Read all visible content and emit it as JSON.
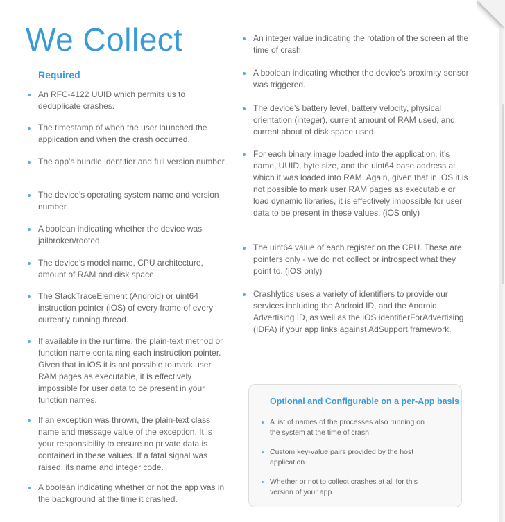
{
  "title": "We Collect",
  "required_heading": "Required",
  "left_items": [
    "An RFC-4122 UUID which permits us to deduplicate crashes.",
    "The timestamp of when the user launched the application and when the crash occurred.",
    "The app’s bundle identifier and full version number.",
    "The device’s operating system name and version number.",
    "A boolean indicating whether the device was jailbroken/rooted.",
    "The device’s model name, CPU architecture, amount of RAM and disk space.",
    "The StackTraceElement (Android) or uint64 instruction pointer (iOS) of every frame of every currently running thread.",
    "If available in the runtime, the plain-text method or function name containing each instruction pointer. Given that in iOS it is not possible to mark user RAM pages as executable, it is effectively impossible for user data to be present in your function names.",
    "If an exception was thrown, the plain-text class name and message value of the exception. It is your responsibility to ensure no private data is contained in these values. If a fatal signal was raised, its name and integer code.",
    "A boolean indicating whether or not the app was in the background at the time it crashed."
  ],
  "right_items": [
    "An integer value indicating the rotation of the screen at the time of crash.",
    "A boolean indicating whether the device’s proximity sensor was triggered.",
    "The device’s battery level, battery velocity, physical orientation (integer), current amount of RAM used, and current about of disk space used.",
    "For each binary image loaded into the application, it’s name, UUID, byte size, and the uint64 base address at which it was loaded into RAM. Again, given that in iOS it is not possible to mark user RAM pages as executable or load dynamic libraries, it is effectively impossible for user data to be present in these values. (iOS only)",
    "The uint64 value of each register on the CPU. These are pointers only - we do not collect or introspect what they point to. (iOS only)",
    "Crashlytics uses a variety of identifiers to provide our services including the Android ID,  and the Android Advertising ID, as well as the iOS identifierForAdvertising (IDFA) if your app links against AdSupport.framework."
  ],
  "optional_box": {
    "title": "Optional and Configurable on a per-App basis",
    "items": [
      "A list of names of the processes also running on the system at the time of crash.",
      "Custom key-value pairs provided by the host application.",
      "Whether or not to collect crashes at all for this version of your app."
    ]
  },
  "colors": {
    "accent": "#3a9ad8",
    "body_text": "#666666",
    "bullet": "#5aa8dc"
  }
}
